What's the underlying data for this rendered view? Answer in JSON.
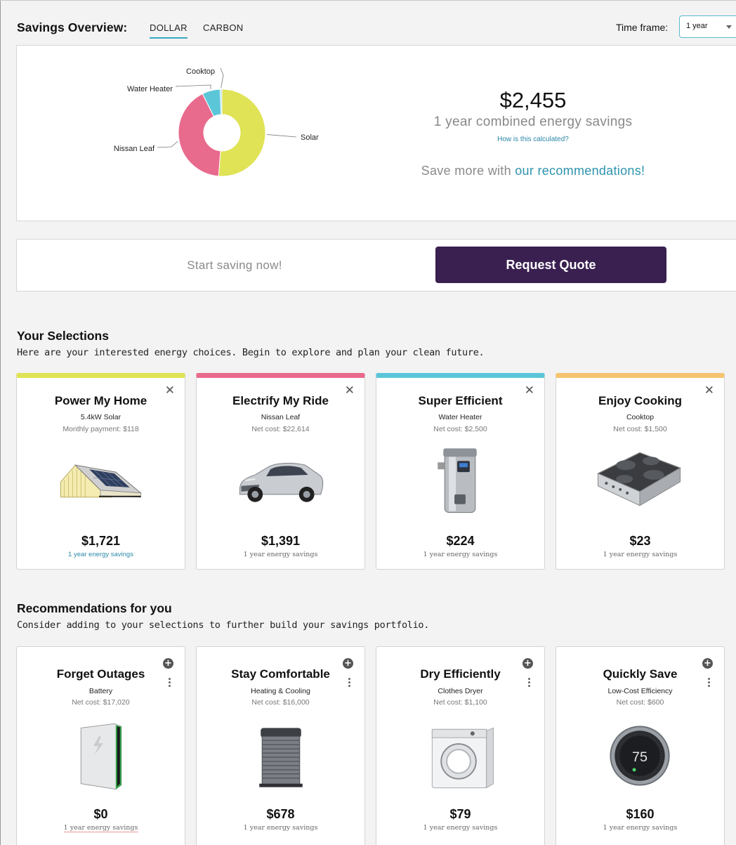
{
  "header": {
    "title": "Savings Overview:",
    "tabs": [
      {
        "label": "DOLLAR",
        "active": true
      },
      {
        "label": "CARBON",
        "active": false
      }
    ],
    "timeframe_label": "Time frame:",
    "timeframe_value": "1 year"
  },
  "overview": {
    "amount": "$2,455",
    "combined_label": "1 year combined energy savings",
    "how_link": "How is this calculated?",
    "save_more_prefix": "Save more with ",
    "save_more_link": "our recommendations!",
    "chart_data": {
      "type": "pie",
      "style": "donut",
      "categories": [
        "Solar",
        "Nissan Leaf",
        "Water Heater",
        "Cooktop"
      ],
      "values": [
        1721,
        1391,
        224,
        23
      ],
      "colors": [
        "#dfe355",
        "#e86a8c",
        "#5cc6d9",
        "#a8dde6"
      ]
    }
  },
  "start": {
    "text": "Start saving now!",
    "button": "Request Quote"
  },
  "selections": {
    "title": "Your Selections",
    "description": "Here are your interested energy choices. Begin to explore and plan your clean future.",
    "cards": [
      {
        "title": "Power My Home",
        "subtitle": "5.4kW Solar",
        "cost": "Monthly payment: $118",
        "amount": "$1,721",
        "note": "1 year energy savings",
        "color": "#dfe355",
        "icon": "solar-house-icon"
      },
      {
        "title": "Electrify My Ride",
        "subtitle": "Nissan Leaf",
        "cost": "Net cost: $22,614",
        "amount": "$1,391",
        "note": "1 year energy savings",
        "color": "#e86a8c",
        "icon": "car-icon"
      },
      {
        "title": "Super Efficient",
        "subtitle": "Water Heater",
        "cost": "Net cost: $2,500",
        "amount": "$224",
        "note": "1 year energy savings",
        "color": "#5cc6d9",
        "icon": "water-heater-icon"
      },
      {
        "title": "Enjoy Cooking",
        "subtitle": "Cooktop",
        "cost": "Net cost: $1,500",
        "amount": "$23",
        "note": "1 year energy savings",
        "color": "#f6c36e",
        "icon": "cooktop-icon"
      }
    ]
  },
  "recommendations": {
    "title": "Recommendations for you",
    "description": "Consider adding to your selections to further build your savings portfolio.",
    "cards": [
      {
        "title": "Forget Outages",
        "subtitle": "Battery",
        "cost": "Net cost: $17,020",
        "amount": "$0",
        "note": "1 year energy savings",
        "icon": "battery-icon"
      },
      {
        "title": "Stay Comfortable",
        "subtitle": "Heating & Cooling",
        "cost": "Net cost: $16,000",
        "amount": "$678",
        "note": "1 year energy savings",
        "icon": "ac-unit-icon"
      },
      {
        "title": "Dry Efficiently",
        "subtitle": "Clothes Dryer",
        "cost": "Net cost: $1,100",
        "amount": "$79",
        "note": "1 year energy savings",
        "icon": "dryer-icon"
      },
      {
        "title": "Quickly Save",
        "subtitle": "Low-Cost Efficiency",
        "cost": "Net cost: $600",
        "amount": "$160",
        "note": "1 year energy savings",
        "thermostat_reading": "75",
        "icon": "thermostat-icon"
      }
    ]
  }
}
